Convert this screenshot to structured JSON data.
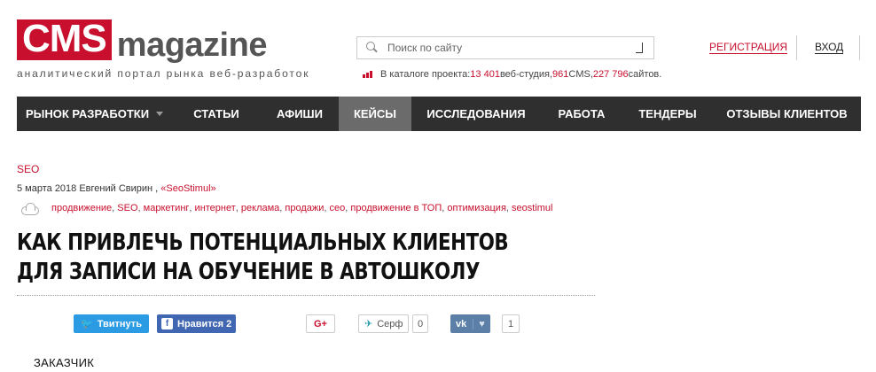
{
  "header": {
    "logo_cms": "CMS",
    "logo_magazine": "magazine",
    "tagline": "аналитический портал рынка веб-разработок",
    "search_placeholder": "Поиск по сайту",
    "register": "РЕГИСТРАЦИЯ",
    "login": "ВХОД",
    "catalog": {
      "prefix": "В каталоге проекта: ",
      "studios_num": "13 401",
      "studios_label": " веб-студия, ",
      "cms_num": "961",
      "cms_label": " CMS, ",
      "sites_num": "227 796",
      "sites_label": " сайтов."
    }
  },
  "nav": [
    {
      "label": "РЫНОК РАЗРАБОТКИ",
      "has_dropdown": true,
      "active": false
    },
    {
      "label": "СТАТЬИ",
      "active": false
    },
    {
      "label": "АФИШИ",
      "active": false
    },
    {
      "label": "КЕЙСЫ",
      "active": true
    },
    {
      "label": "ИССЛЕДОВАНИЯ",
      "active": false
    },
    {
      "label": "РАБОТА",
      "active": false
    },
    {
      "label": "ТЕНДЕРЫ",
      "active": false
    },
    {
      "label": "ОТЗЫВЫ КЛИЕНТОВ",
      "active": false
    }
  ],
  "article": {
    "rubric": "SEO",
    "date_author": "5 марта 2018 Евгений Свирин , ",
    "company": "«SeoStimul»",
    "tags": [
      "продвижение",
      "SEO",
      "маркетинг",
      "интернет",
      "реклама",
      "продажи",
      "сео",
      "продвижение в ТОП",
      "оптимизация",
      "seostimul"
    ],
    "title_line1": "Как привлечь потенциальных клиентов",
    "title_line2": "для записи на обучение в автошколу",
    "section_heading": "ЗАКАЗЧИК"
  },
  "social": {
    "twitter": "Твитнуть",
    "facebook": "Нравится 2",
    "gplus": "G+",
    "surf": "Серф",
    "surf_count": "0",
    "vk_count": "1"
  },
  "colors": {
    "brand_red": "#c8102e",
    "nav_bg": "#2f2f2f",
    "nav_active": "#6b6b6b"
  }
}
